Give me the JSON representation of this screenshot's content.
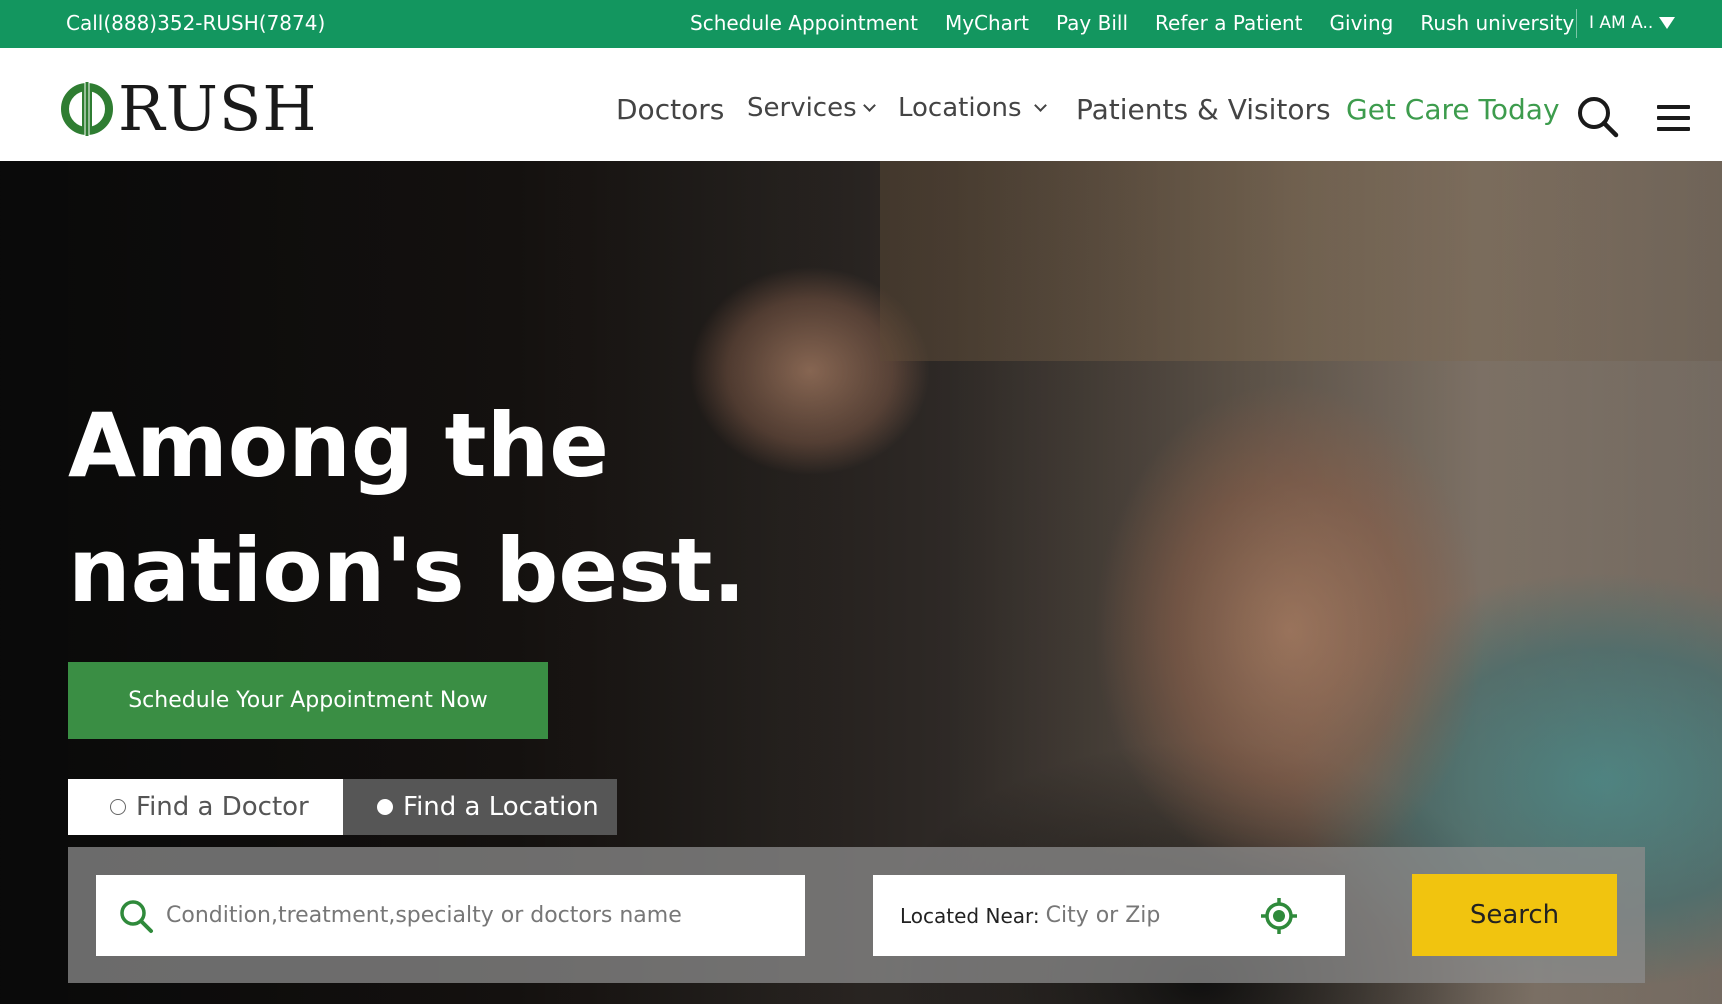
{
  "topbar": {
    "phone": "Call(888)352-RUSH(7874)",
    "links": [
      "Schedule Appointment",
      "MyChart",
      "Pay Bill",
      "Refer a Patient",
      "Giving",
      "Rush university"
    ],
    "iam_label": "I AM A.."
  },
  "brand": {
    "name": "RUSH",
    "color": "#2f7d32"
  },
  "nav": {
    "doctors": "Doctors",
    "services": "Services",
    "locations": "Locations",
    "patients": "Patients & Visitors",
    "get_care": "Get Care Today"
  },
  "hero": {
    "headline_line1": "Among the",
    "headline_line2": "nation's best.",
    "cta_label": "Schedule Your Appointment Now"
  },
  "finder": {
    "tab_doctor": "Find a Doctor",
    "tab_location": "Find a Location",
    "active_tab": "Find a Location",
    "keyword_placeholder": "Condition,treatment,specialty or doctors name",
    "located_near_label": "Located Near:",
    "location_placeholder": "City or Zip",
    "search_label": "Search"
  },
  "colors": {
    "topbar": "#13965f",
    "accent_green": "#3a8e44",
    "get_care_green": "#3d9c4d",
    "search_button": "#f1c40f"
  },
  "icons": [
    "search-icon",
    "menu-icon",
    "location-target-icon",
    "chevron-down-icon",
    "caret-down-icon"
  ]
}
